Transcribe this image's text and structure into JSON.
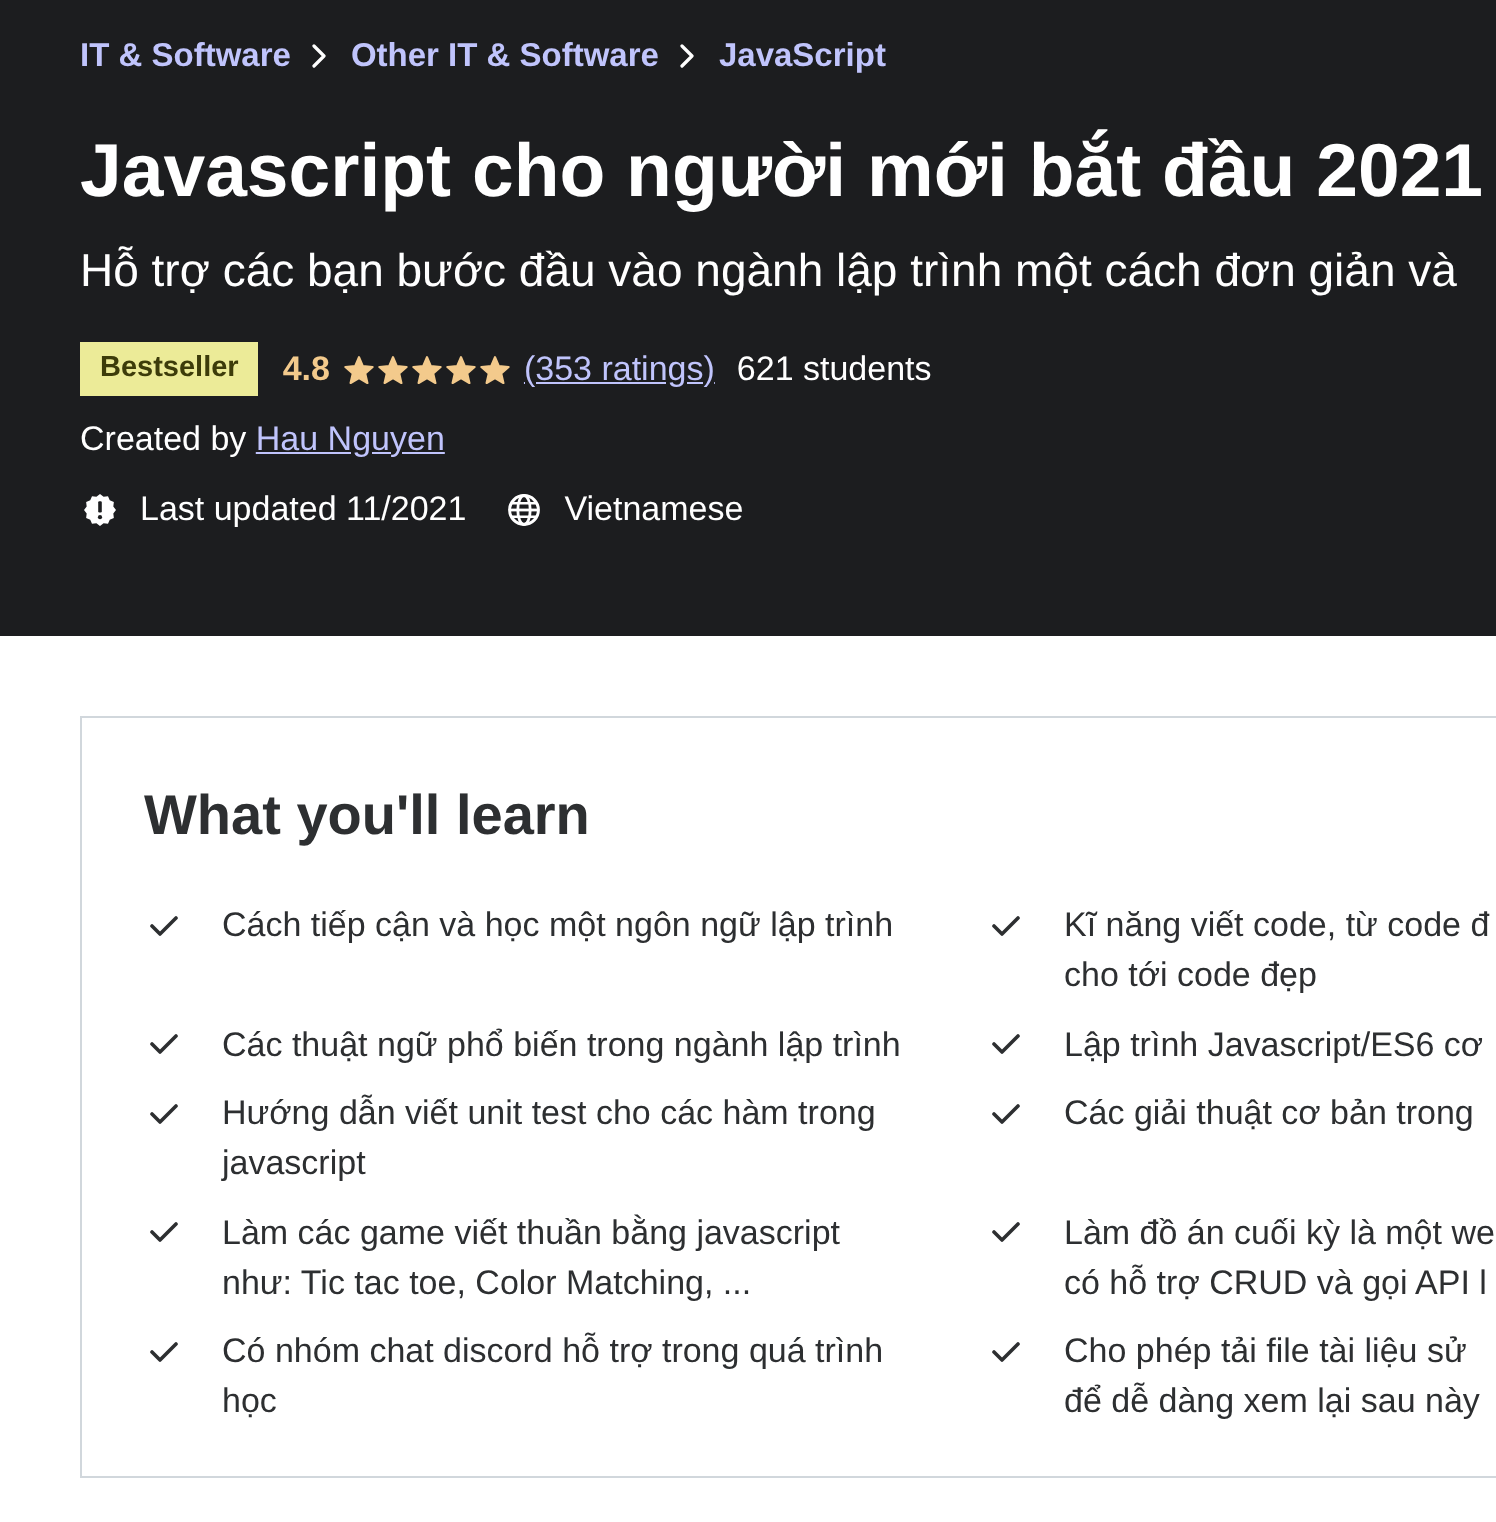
{
  "breadcrumb": [
    "IT & Software",
    "Other IT & Software",
    "JavaScript"
  ],
  "course": {
    "title": "Javascript cho người mới bắt đầu 2021",
    "subtitle": "Hỗ trợ các bạn bước đầu vào ngành lập trình một cách đơn giản và",
    "badge": "Bestseller",
    "rating": "4.8",
    "stars": 5,
    "ratings_link": "(353 ratings)",
    "students": "621 students",
    "created_by_label": "Created by",
    "instructor": "Hau Nguyen",
    "last_updated": "Last updated 11/2021",
    "language": "Vietnamese"
  },
  "learn": {
    "title": "What you'll learn",
    "items": [
      {
        "lines": [
          "Cách tiếp cận và học một ngôn ngữ lập trình"
        ]
      },
      {
        "lines": [
          "Kĩ năng viết code, từ code đ",
          "cho tới code đẹp"
        ]
      },
      {
        "lines": [
          "Các thuật ngữ phổ biến trong ngành lập trình"
        ]
      },
      {
        "lines": [
          "Lập trình Javascript/ES6 cơ"
        ]
      },
      {
        "lines": [
          "Hướng dẫn viết unit test cho các hàm trong",
          "javascript"
        ]
      },
      {
        "lines": [
          "Các giải thuật cơ bản trong"
        ]
      },
      {
        "lines": [
          "Làm các game viết thuần bằng javascript",
          "như: Tic tac toe, Color Matching, ..."
        ]
      },
      {
        "lines": [
          "Làm đồ án cuối kỳ là một we",
          "có hỗ trợ CRUD và gọi API l"
        ]
      },
      {
        "lines": [
          "Có nhóm chat discord hỗ trợ trong quá trình",
          "học"
        ]
      },
      {
        "lines": [
          "Cho phép tải file tài liệu sử",
          "để dễ dàng xem lại sau này"
        ]
      }
    ]
  }
}
